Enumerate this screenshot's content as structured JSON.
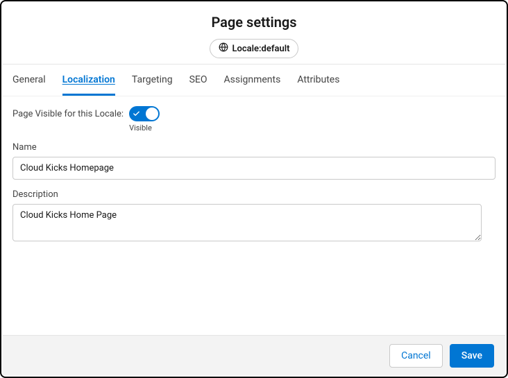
{
  "header": {
    "title": "Page settings",
    "locale_label": "Locale:default"
  },
  "tabs": [
    {
      "label": "General",
      "active": false
    },
    {
      "label": "Localization",
      "active": true
    },
    {
      "label": "Targeting",
      "active": false
    },
    {
      "label": "SEO",
      "active": false
    },
    {
      "label": "Assignments",
      "active": false
    },
    {
      "label": "Attributes",
      "active": false
    }
  ],
  "form": {
    "visibility_label": "Page Visible for this Locale:",
    "visibility_state": "Visible",
    "name_label": "Name",
    "name_value": "Cloud Kicks Homepage",
    "description_label": "Description",
    "description_value": "Cloud Kicks Home Page"
  },
  "footer": {
    "cancel_label": "Cancel",
    "save_label": "Save"
  }
}
